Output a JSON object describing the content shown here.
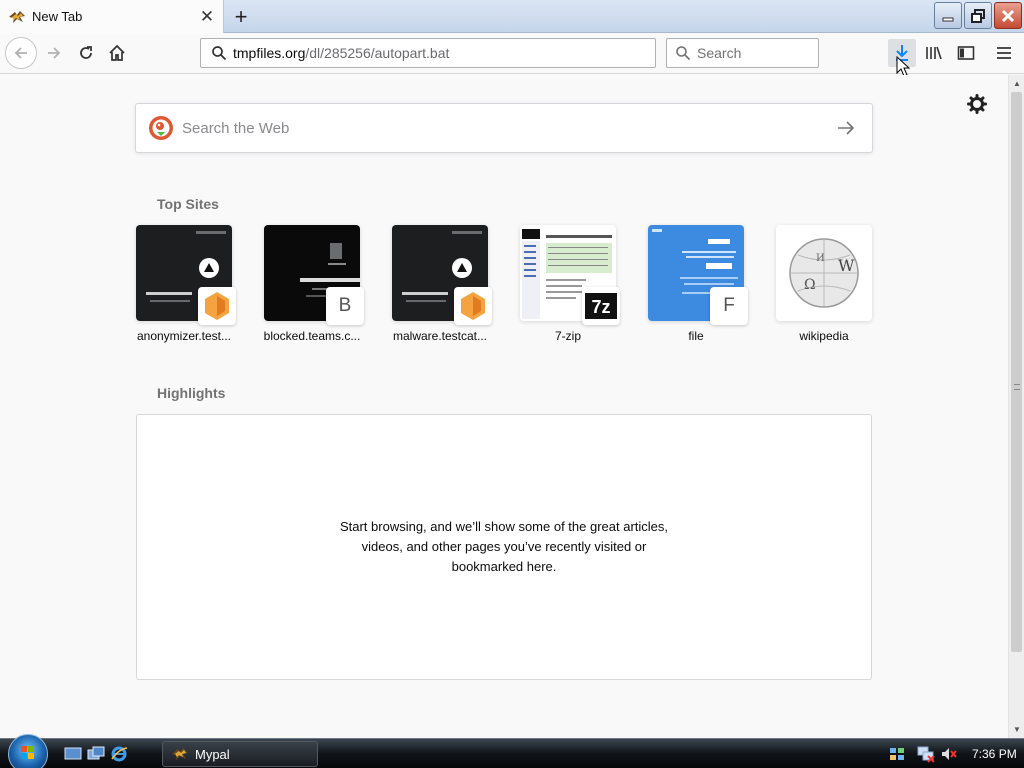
{
  "window": {
    "tab_title": "New Tab",
    "new_tab_symbol": "+",
    "tab_close_symbol": "✕"
  },
  "navbar": {
    "url_host": "tmpfiles.org",
    "url_path": "/dl/285256/autopart.bat",
    "search_placeholder": "Search"
  },
  "newtab": {
    "web_search_placeholder": "Search the Web",
    "top_sites_title": "Top Sites",
    "top_sites": [
      {
        "label": "anonymizer.test...",
        "badge": ""
      },
      {
        "label": "blocked.teams.c...",
        "badge": "B"
      },
      {
        "label": "malware.testcat...",
        "badge": ""
      },
      {
        "label": "7-zip",
        "badge": "7z"
      },
      {
        "label": "file",
        "badge": "F"
      },
      {
        "label": "wikipedia",
        "badge": ""
      }
    ],
    "highlights_title": "Highlights",
    "highlights_empty_text": "Start browsing, and we’ll show some of the great articles, videos, and other pages you’ve recently visited or bookmarked here."
  },
  "taskbar": {
    "app_label": "Mypal",
    "clock": "7:36 PM"
  },
  "colors": {
    "accent": "#0a84ff",
    "close_red": "#c54a34",
    "file_tile_blue": "#3d8be0"
  },
  "icons": {
    "tab": "mypal-app-icon",
    "back": "back-arrow-icon",
    "forward": "forward-arrow-icon",
    "reload": "reload-icon",
    "home": "home-icon",
    "url": "search-icon",
    "downloads": "download-icon",
    "library": "library-icon",
    "sidebar": "sidebar-icon",
    "menu": "hamburger-menu-icon",
    "settings": "gear-icon"
  }
}
